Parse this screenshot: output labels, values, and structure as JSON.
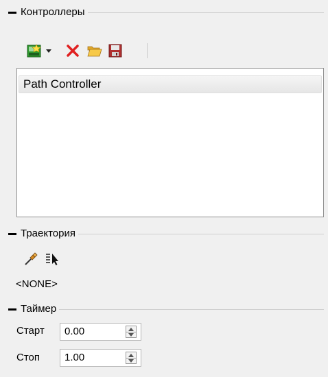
{
  "controllers": {
    "title": "Контроллеры",
    "list": [
      {
        "label": "Path Controller",
        "selected": true
      }
    ],
    "toolbar": {
      "icons": [
        "add-controller-icon",
        "dropdown-arrow-icon",
        "delete-icon",
        "open-folder-icon",
        "save-icon"
      ]
    }
  },
  "trajectory": {
    "title": "Траектория",
    "toolbar": {
      "icons": [
        "pick-path-icon",
        "select-from-list-icon"
      ]
    },
    "current": "<NONE>"
  },
  "timer": {
    "title": "Таймер",
    "start": {
      "label": "Старт",
      "value": "0.00"
    },
    "stop": {
      "label": "Стоп",
      "value": "1.00"
    }
  },
  "colors": {
    "delete": "#e02020",
    "folder": "#f5c242",
    "add": "#2e9a2e",
    "save": "#b03030"
  }
}
